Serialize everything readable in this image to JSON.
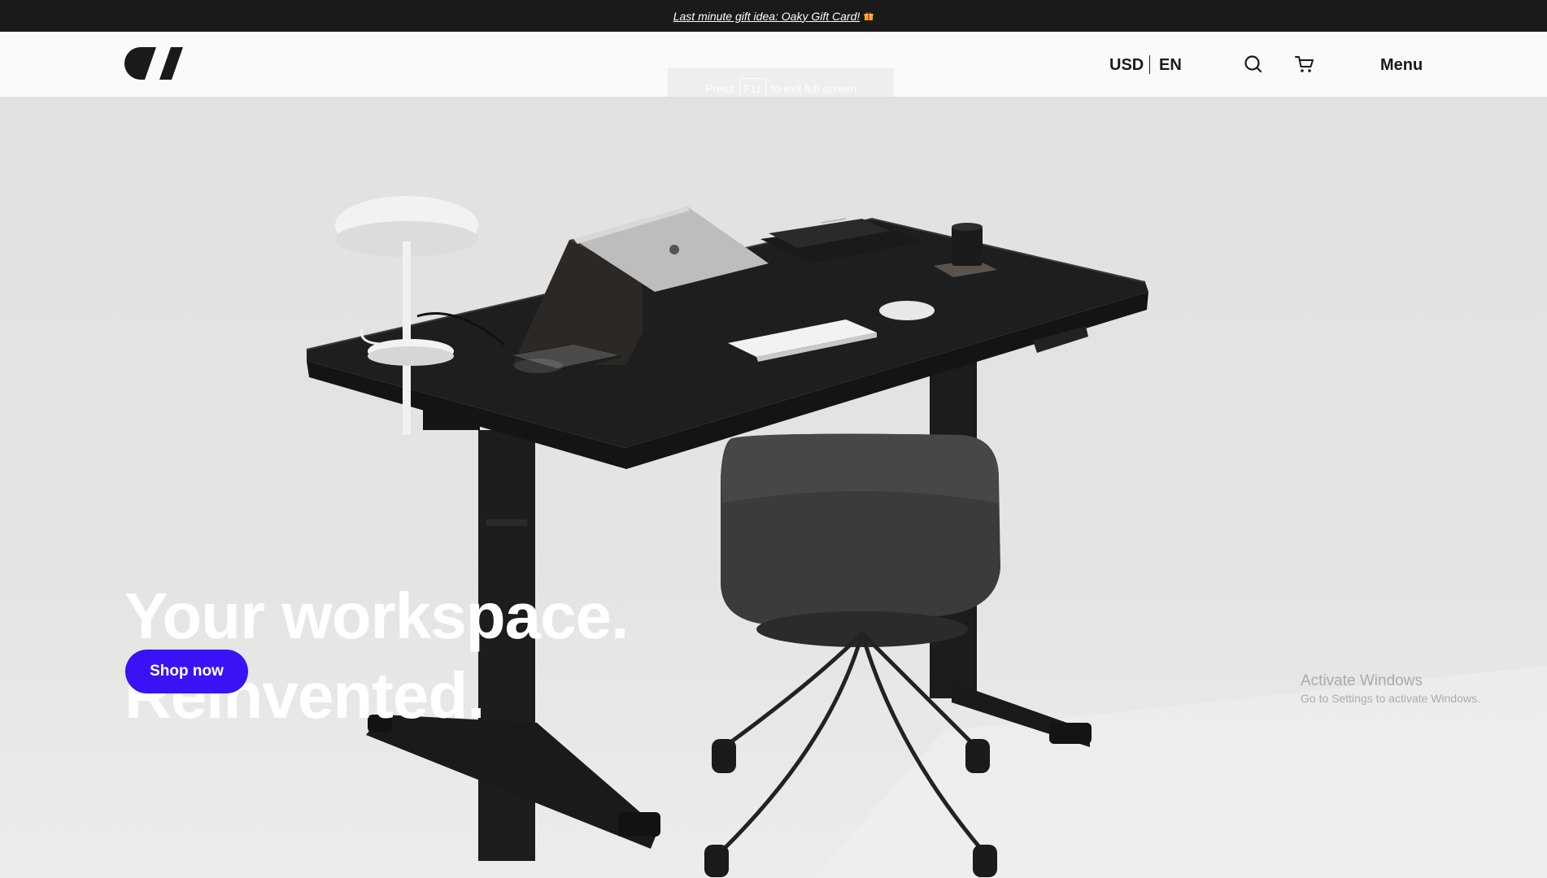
{
  "announcement": {
    "text": "Last minute gift idea: Oaky Gift Card!",
    "gift_icon": "gift-icon",
    "gift_color": "#f5a623"
  },
  "header": {
    "logo": "oakywood-logo",
    "fullscreen_toast": {
      "press": "Press",
      "key": "F11",
      "rest": "to exit full screen"
    },
    "currency": "USD",
    "language": "EN",
    "search_icon": "search-icon",
    "cart_icon": "cart-icon",
    "menu_label": "Menu"
  },
  "hero": {
    "title_line1": "Your workspace.",
    "title_line2": "Reinvented.",
    "cta_label": "Shop now",
    "cta_color": "#3a12f5"
  },
  "watermark": {
    "line1": "Activate Windows",
    "line2": "Go to Settings to activate Windows."
  }
}
